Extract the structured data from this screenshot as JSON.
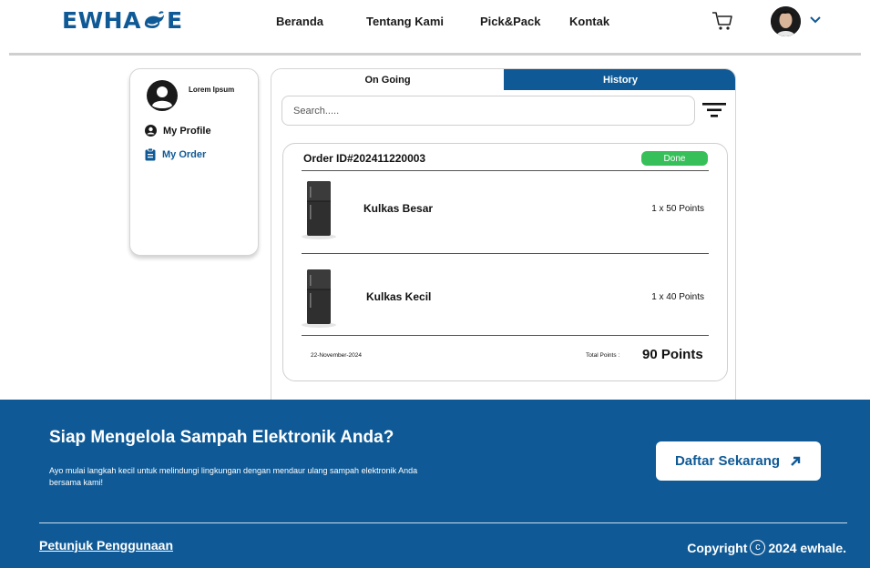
{
  "header": {
    "logo_left": "EWHA",
    "logo_right": "E",
    "nav": [
      "Beranda",
      "Tentang Kami",
      "Pick&Pack",
      "Kontak"
    ]
  },
  "profile": {
    "name": "Lorem Ipsum",
    "menu": [
      {
        "label": "My Profile",
        "icon": "user-circle-icon"
      },
      {
        "label": "My Order",
        "icon": "clipboard-icon",
        "active": true
      }
    ]
  },
  "orders": {
    "tabs": [
      "On Going",
      "History"
    ],
    "active_tab": "History",
    "search_placeholder": "Search.....",
    "order": {
      "id": "Order ID#202411220003",
      "status": "Done",
      "items": [
        {
          "name": "Kulkas Besar",
          "qty": "1 x 50 Points"
        },
        {
          "name": "Kulkas Kecil",
          "qty": "1 x 40 Points"
        }
      ],
      "date": "22-November-2024",
      "total_label": "Total Points :",
      "total_value": "90 Points"
    }
  },
  "footer": {
    "title": "Siap Mengelola Sampah Elektronik Anda?",
    "description": "Ayo mulai langkah kecil untuk melindungi lingkungan dengan mendaur ulang sampah elektronik Anda bersama kami!",
    "cta": "Daftar Sekarang",
    "link": "Petunjuk Penggunaan",
    "copyright_prefix": "Copyright",
    "copyright_symbol": "c",
    "copyright_suffix": "2024 ewhale."
  },
  "colors": {
    "brand": "#0f5a96",
    "status_done": "#37c05a"
  }
}
